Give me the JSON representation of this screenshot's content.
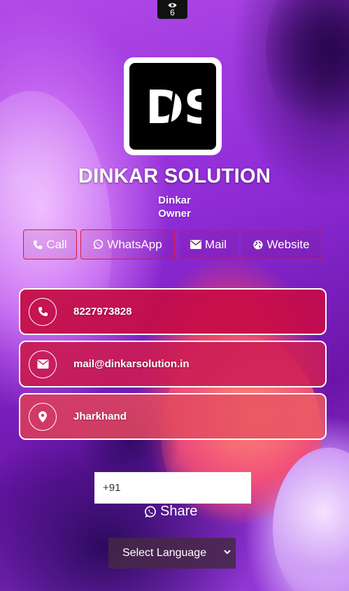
{
  "views": {
    "count": "6",
    "icon": "eye-icon"
  },
  "logo": {
    "text": "DS"
  },
  "profile": {
    "company": "DINKAR SOLUTION",
    "person": "Dinkar",
    "role": "Owner"
  },
  "actions": [
    {
      "label": "Call",
      "icon": "phone-icon"
    },
    {
      "label": "WhatsApp",
      "icon": "whatsapp-icon"
    },
    {
      "label": "Mail",
      "icon": "envelope-icon"
    },
    {
      "label": "Website",
      "icon": "globe-icon"
    }
  ],
  "contacts": [
    {
      "value": "8227973828",
      "icon": "phone-icon",
      "color": "#c40f48"
    },
    {
      "value": "mail@dinkarsolution.in",
      "icon": "envelope-icon",
      "color": "#c91a52"
    },
    {
      "value": "Jharkhand",
      "icon": "location-pin-icon",
      "color": "#d93a5c"
    }
  ],
  "share": {
    "input_value": "+91",
    "label": "Share",
    "icon": "whatsapp-icon"
  },
  "language": {
    "label": "Select Language"
  },
  "colors": {
    "accent_border": "#e0173c",
    "card_text": "#ffffff"
  }
}
